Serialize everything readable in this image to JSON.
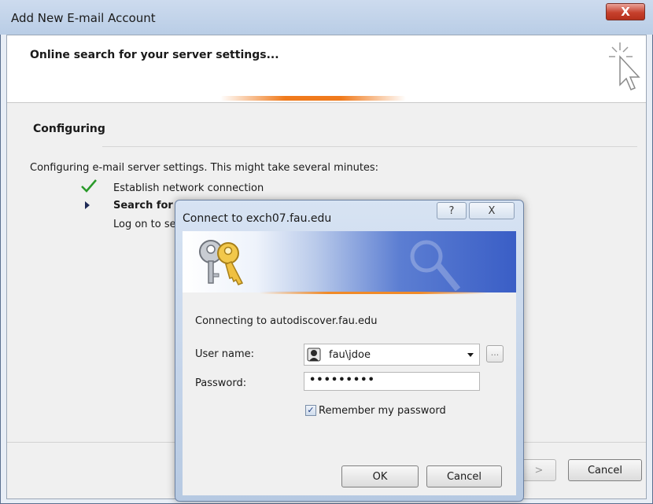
{
  "outer_window": {
    "title": "Add New E-mail Account",
    "close_glyph": "X",
    "heading": "Online search for your server settings...",
    "header_icon": "cursor-sparkle-icon",
    "progress_bar": "indeterminate",
    "section_title": "Configuring",
    "description": "Configuring e-mail server settings. This might take several minutes:",
    "steps": [
      {
        "label": "Establish network connection",
        "status": "done",
        "icon": "checkmark-icon"
      },
      {
        "label": "Search for",
        "status": "in-progress",
        "icon": "arrow-right-icon"
      },
      {
        "label": "Log on to se",
        "status": "pending"
      }
    ],
    "buttons": {
      "next": ">",
      "cancel": "Cancel"
    }
  },
  "inner_dialog": {
    "title": "Connect to exch07.fau.edu",
    "help_glyph": "?",
    "close_glyph": "X",
    "banner_icon": "keys-icon",
    "connecting_text": "Connecting to autodiscover.fau.edu",
    "username_label": "User name:",
    "username_value": "fau\\jdoe",
    "browse_label": "...",
    "password_label": "Password:",
    "password_value": "•••••••••",
    "remember_label": "Remember my password",
    "remember_checked": true,
    "check_glyph": "✓",
    "ok_label": "OK",
    "cancel_label": "Cancel"
  },
  "colors": {
    "accent_orange": "#f07a1c",
    "banner_blue": "#3a5ec6",
    "check_green": "#2a9a2a"
  }
}
